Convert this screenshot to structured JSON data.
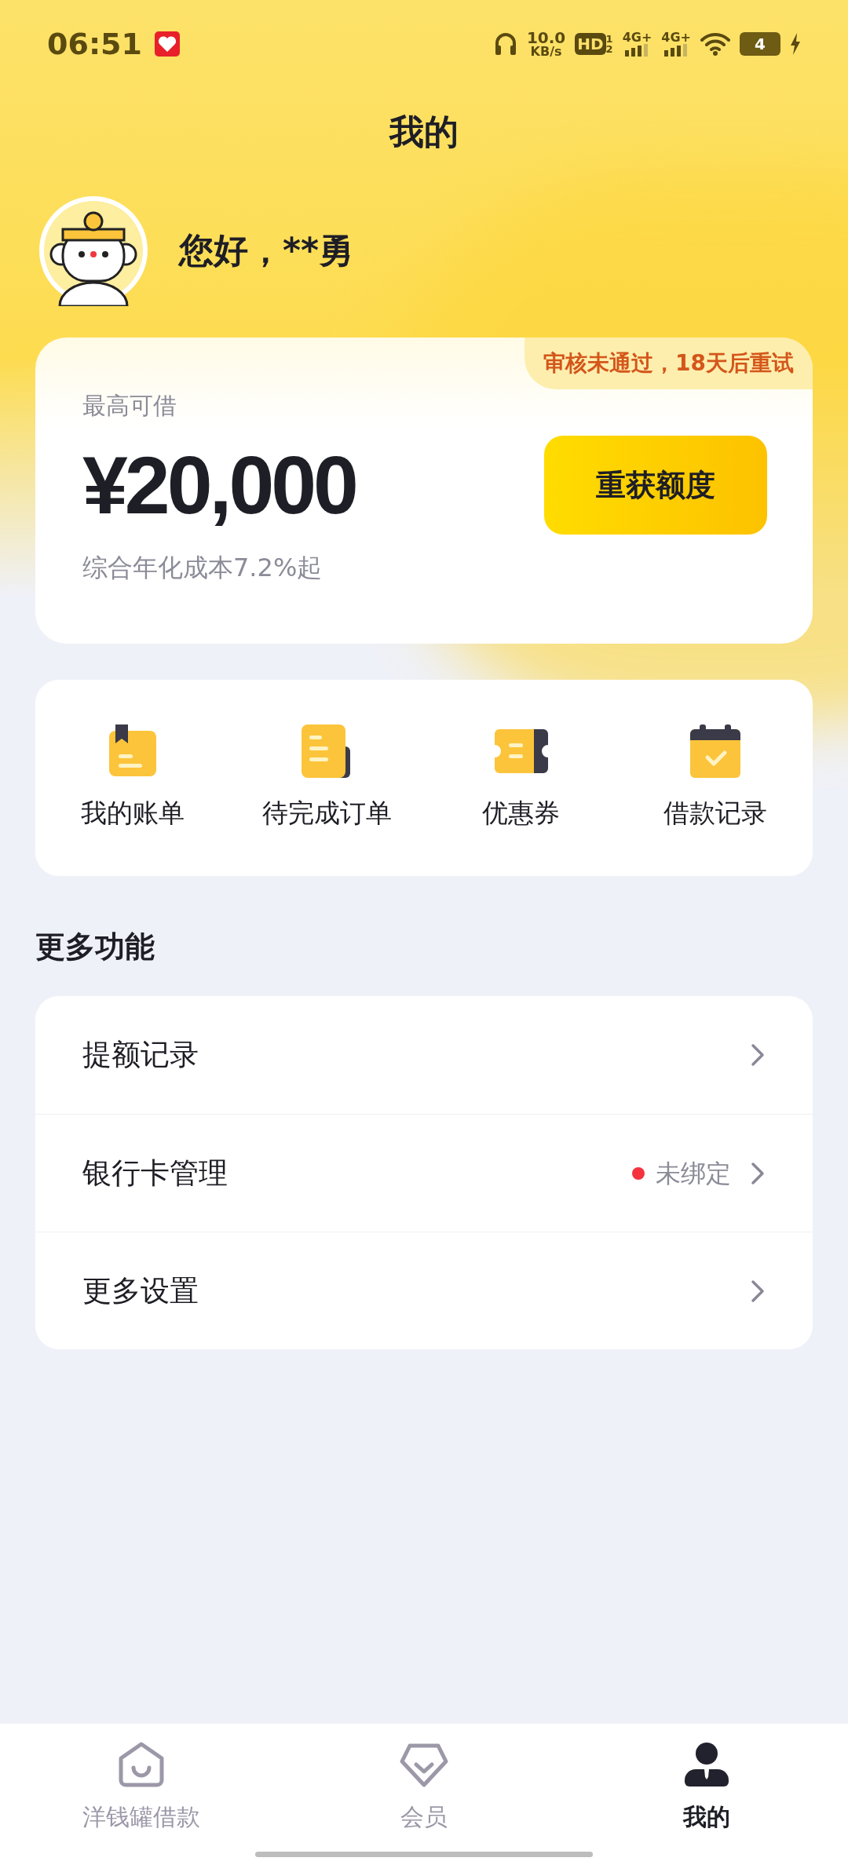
{
  "status_bar": {
    "time": "06:51",
    "net_speed": "10.0",
    "net_unit": "KB/s",
    "hd": "HD",
    "hd_sims": [
      "1",
      "2"
    ],
    "signals": [
      "4G+",
      "4G+"
    ],
    "battery": "4"
  },
  "header": {
    "title": "我的"
  },
  "profile": {
    "greeting": "您好，**勇"
  },
  "credit_card": {
    "notice": "审核未通过，18天后重试",
    "label": "最高可借",
    "amount": "¥20,000",
    "button": "重获额度",
    "rate": "综合年化成本7.2%起"
  },
  "shortcuts": [
    {
      "kind": "bill",
      "label": "我的账单"
    },
    {
      "kind": "order",
      "label": "待完成订单"
    },
    {
      "kind": "coupon",
      "label": "优惠券"
    },
    {
      "kind": "record",
      "label": "借款记录"
    }
  ],
  "more": {
    "title": "更多功能",
    "rows": [
      {
        "label": "提额记录"
      },
      {
        "label": "银行卡管理",
        "status": "未绑定",
        "color": "#f5333f"
      },
      {
        "label": "更多设置"
      }
    ]
  },
  "tab_bar": [
    {
      "kind": "home",
      "label": "洋钱罐借款",
      "selected": false
    },
    {
      "kind": "member",
      "label": "会员",
      "selected": false
    },
    {
      "kind": "me",
      "label": "我的",
      "selected": true
    }
  ]
}
